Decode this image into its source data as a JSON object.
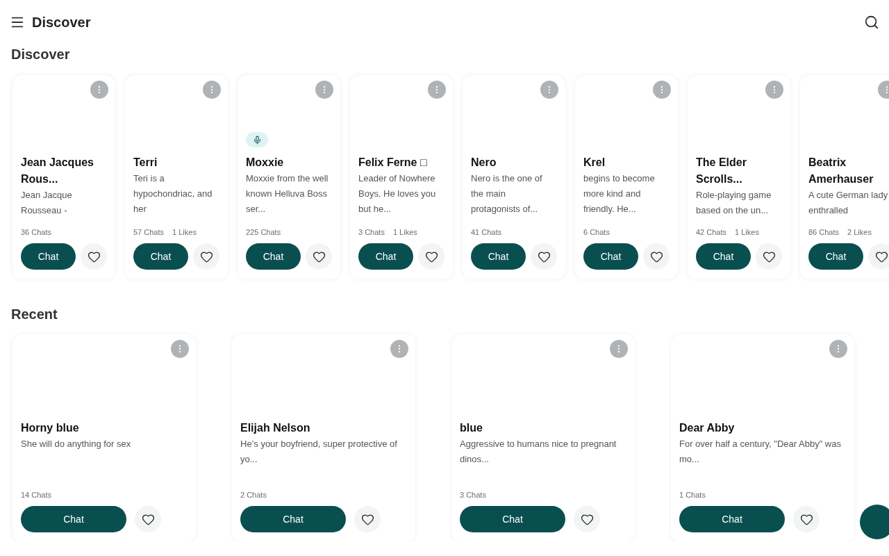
{
  "header": {
    "title": "Discover"
  },
  "discover": {
    "heading": "Discover",
    "cards": [
      {
        "name": "Jean Jacques Rous...",
        "description": "Jean Jacque Rousseau -",
        "chats": "36 Chats",
        "voice": false,
        "button": "Chat"
      },
      {
        "name": "Terri",
        "description": "Teri is a hypochondriac, and her",
        "chats": "57 Chats",
        "likes": "1 Likes",
        "voice": false,
        "button": "Chat"
      },
      {
        "name": "Moxxie",
        "description": "Moxxie from the well known Helluva Boss ser...",
        "chats": "225 Chats",
        "voice": true,
        "button": "Chat"
      },
      {
        "name": "Felix Ferne □",
        "description": "Leader of Nowhere Boys. He loves you but he...",
        "chats": "3 Chats",
        "likes": "1 Likes",
        "voice": false,
        "button": "Chat"
      },
      {
        "name": "Nero",
        "description": "Nero is the one of the main protagonists of...",
        "chats": "41 Chats",
        "voice": false,
        "button": "Chat"
      },
      {
        "name": "Krel",
        "description": "begins to become more kind and friendly. He...",
        "chats": "6 Chats",
        "voice": false,
        "button": "Chat"
      },
      {
        "name": "The Elder Scrolls...",
        "description": "Role-playing game based on the un...",
        "chats": "42 Chats",
        "likes": "1 Likes",
        "voice": false,
        "button": "Chat"
      },
      {
        "name": "Beatrix Amerhauser",
        "description": "A cute German lady enthralled",
        "chats": "86 Chats",
        "likes": "2 Likes",
        "voice": false,
        "button": "Chat"
      }
    ]
  },
  "recent": {
    "heading": "Recent",
    "cards": [
      {
        "name": "Horny blue",
        "description": "She will do anything for sex",
        "chats": "14 Chats",
        "button": "Chat"
      },
      {
        "name": "Elijah Nelson",
        "description": "He’s your boyfriend, super protective of yo...",
        "chats": "2 Chats",
        "button": "Chat"
      },
      {
        "name": "blue",
        "description": "Aggressive to humans nice to pregnant dinos...",
        "chats": "3 Chats",
        "button": "Chat"
      },
      {
        "name": "Dear Abby",
        "description": "For over half a century, \"Dear Abby\" was mo...",
        "chats": "1 Chats",
        "button": "Chat"
      }
    ]
  }
}
